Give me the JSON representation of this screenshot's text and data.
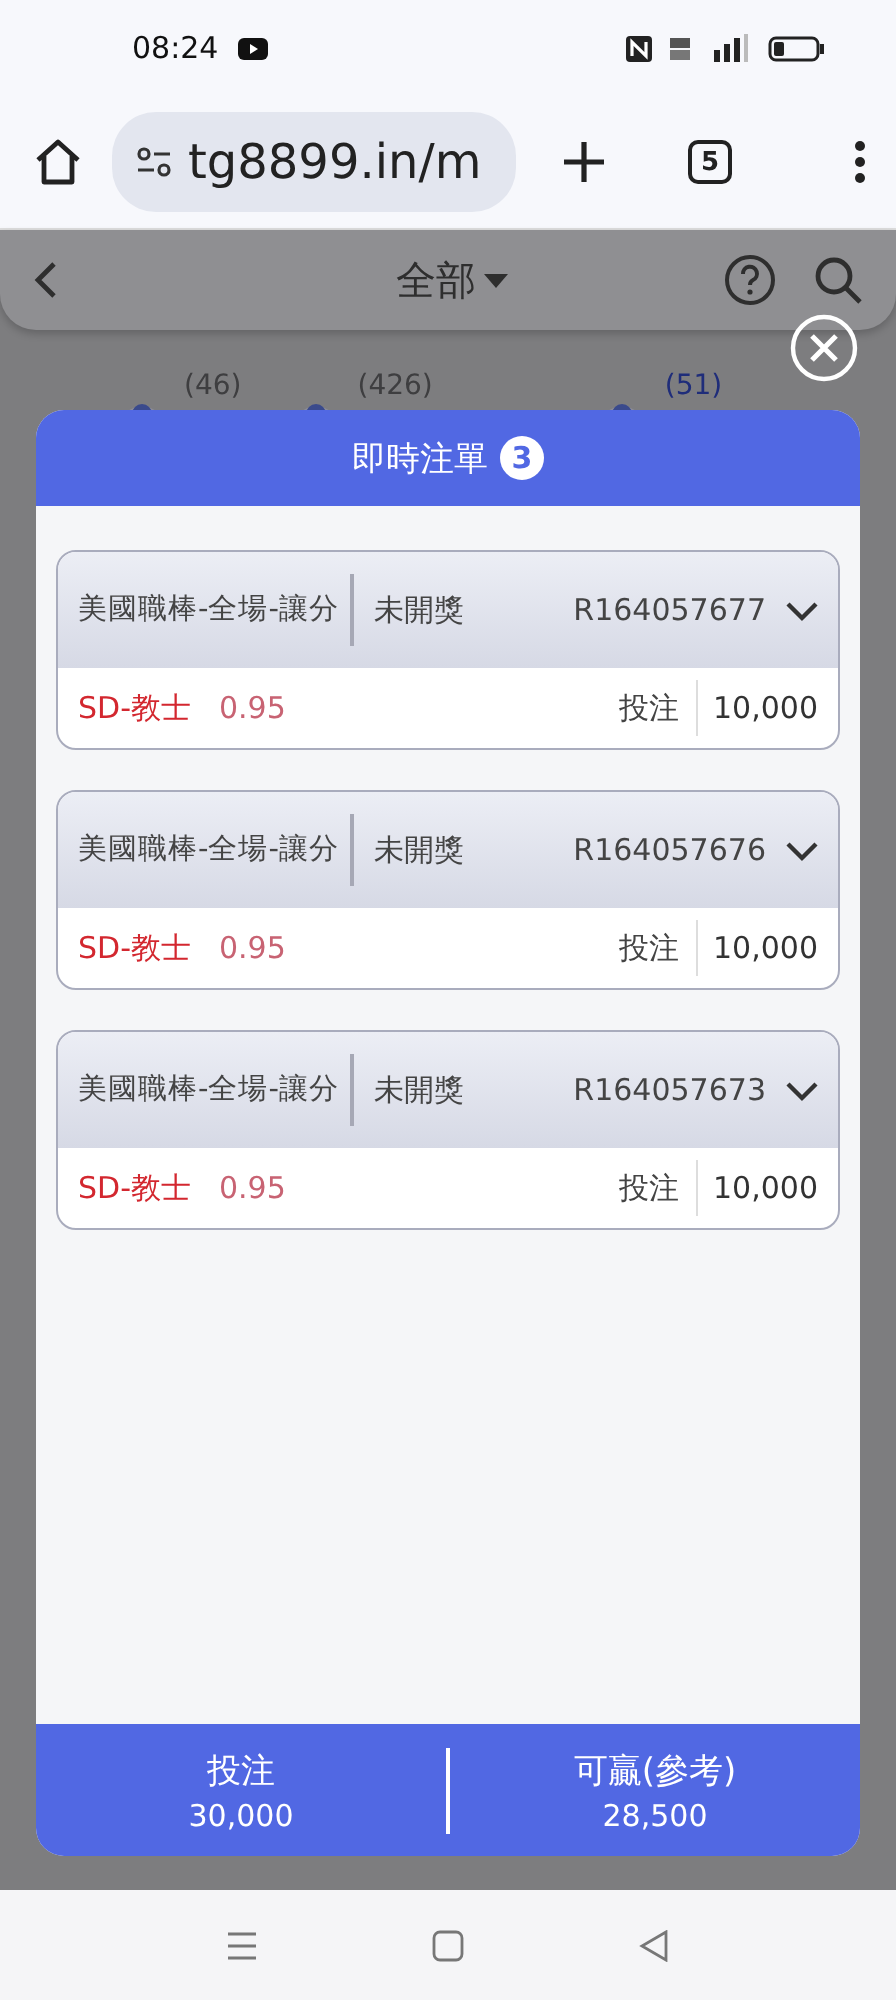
{
  "status_bar": {
    "time": "08:24"
  },
  "browser": {
    "url": "tg8899.in/m",
    "tab_count": "5"
  },
  "page_header": {
    "title": "全部"
  },
  "sport_counts": [
    {
      "count": "(46)",
      "selected": false
    },
    {
      "count": "(426)",
      "selected": false
    },
    {
      "count": "(51)",
      "selected": true
    }
  ],
  "dialog": {
    "title": "即時注單",
    "badge": "3",
    "bets": [
      {
        "market": "美國職棒-全場-讓分",
        "status": "未開獎",
        "ticket": "R164057677",
        "selection": "SD-教士",
        "odds": "0.95",
        "stake_label": "投注",
        "stake": "10,000"
      },
      {
        "market": "美國職棒-全場-讓分",
        "status": "未開獎",
        "ticket": "R164057676",
        "selection": "SD-教士",
        "odds": "0.95",
        "stake_label": "投注",
        "stake": "10,000"
      },
      {
        "market": "美國職棒-全場-讓分",
        "status": "未開獎",
        "ticket": "R164057673",
        "selection": "SD-教士",
        "odds": "0.95",
        "stake_label": "投注",
        "stake": "10,000"
      }
    ],
    "summary": [
      {
        "label": "投注",
        "value": "30,000"
      },
      {
        "label": "可贏(參考)",
        "value": "28,500"
      }
    ]
  }
}
